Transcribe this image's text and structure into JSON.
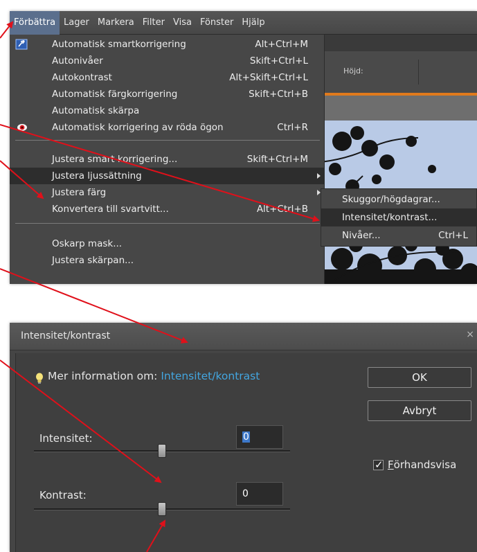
{
  "menubar": {
    "items": [
      "Förbättra",
      "Lager",
      "Markera",
      "Filter",
      "Visa",
      "Fönster",
      "Hjälp"
    ]
  },
  "toolbar": {
    "height_label": "Höjd:"
  },
  "menu": {
    "items": [
      {
        "label": "Automatisk smartkorrigering",
        "shortcut": "Alt+Ctrl+M",
        "icon": "smart-fix-icon"
      },
      {
        "label": "Autonivåer",
        "shortcut": "Skift+Ctrl+L"
      },
      {
        "label": "Autokontrast",
        "shortcut": "Alt+Skift+Ctrl+L"
      },
      {
        "label": "Automatisk färgkorrigering",
        "shortcut": "Skift+Ctrl+B"
      },
      {
        "label": "Automatisk skärpa",
        "shortcut": ""
      },
      {
        "label": "Automatisk korrigering av röda ögon",
        "shortcut": "Ctrl+R",
        "icon": "red-eye-icon"
      },
      {
        "label": "Justera smart korrigering...",
        "shortcut": "Skift+Ctrl+M"
      },
      {
        "label": "Justera ljussättning",
        "shortcut": ""
      },
      {
        "label": "Justera färg",
        "shortcut": ""
      },
      {
        "label": "Konvertera till svartvitt...",
        "shortcut": "Alt+Ctrl+B"
      },
      {
        "label": "Oskarp mask...",
        "shortcut": ""
      },
      {
        "label": "Justera skärpan...",
        "shortcut": ""
      }
    ]
  },
  "submenu": {
    "items": [
      {
        "label": "Skuggor/högdagrar...",
        "shortcut": ""
      },
      {
        "label": "Intensitet/kontrast...",
        "shortcut": ""
      },
      {
        "label": "Nivåer...",
        "shortcut": "Ctrl+L"
      }
    ]
  },
  "dialog": {
    "title": "Intensitet/kontrast",
    "close": "×",
    "info_prefix": "Mer information om:",
    "info_link": "Intensitet/kontrast",
    "ok": "OK",
    "cancel": "Avbryt",
    "preview_first": "F",
    "preview_rest": "örhandsvisa",
    "intensity_label": "Intensitet:",
    "intensity_value": "0",
    "contrast_label": "Kontrast:",
    "contrast_value": "0",
    "intensity_level": 0,
    "contrast_level": 0
  },
  "colors": {
    "accent_link": "#43a6e0",
    "arrow": "#e0101a",
    "highlight_menu": "#5b6f8d"
  }
}
